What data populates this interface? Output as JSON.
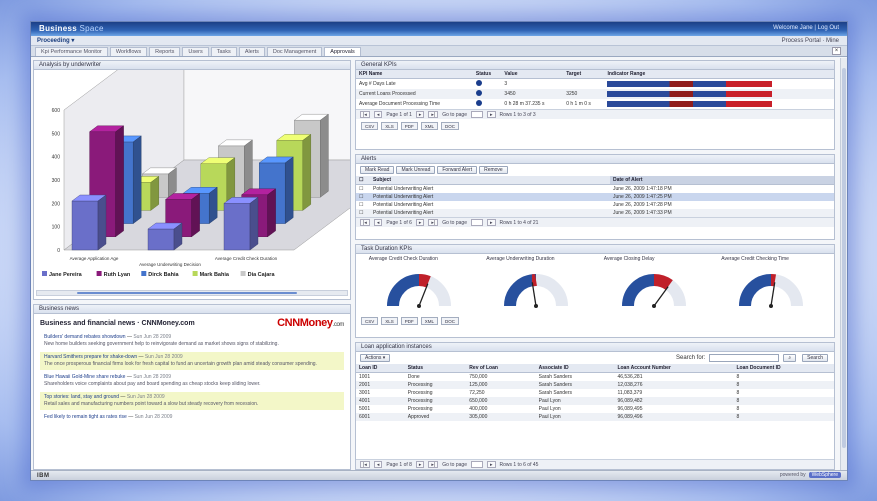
{
  "app": {
    "brand_main": "Business",
    "brand_sub": "Space",
    "top_right": "Welcome Jane | Log Out",
    "menu_title": "Proceeding ▾",
    "menu_right": "Process Portal · Mine"
  },
  "tabs": [
    {
      "label": "Kpi Performance Monitor"
    },
    {
      "label": "Workflows"
    },
    {
      "label": "Reports"
    },
    {
      "label": "Users"
    },
    {
      "label": "Tasks"
    },
    {
      "label": "Alerts"
    },
    {
      "label": "Doc Management"
    },
    {
      "label": "Approvals"
    }
  ],
  "chart_panel": {
    "title": "Analysis by underwriter"
  },
  "chart_data": {
    "type": "bar",
    "title": "",
    "categories": [
      "Average Application Age",
      "Average Underwriting Decision",
      "Average Credit Check Duration"
    ],
    "ylim": [
      0,
      600
    ],
    "yticks": [
      "0",
      "100",
      "200",
      "300",
      "400",
      "500",
      "600"
    ],
    "series": [
      {
        "name": "Jane Pereira",
        "color": "#6a6fc9",
        "values": [
          210,
          90,
          200
        ]
      },
      {
        "name": "Ruth Lyan",
        "color": "#8a1a7a",
        "values": [
          450,
          160,
          180
        ]
      },
      {
        "name": "Dirck Bahia",
        "color": "#4474cc",
        "values": [
          350,
          130,
          260
        ]
      },
      {
        "name": "Mark Bahia",
        "color": "#b8d85a",
        "values": [
          120,
          200,
          300
        ]
      },
      {
        "name": "Dia Cajara",
        "color": "#c8c8c8",
        "values": [
          100,
          220,
          330
        ]
      }
    ],
    "legend_position": "bottom",
    "grid": true
  },
  "news": {
    "panel_title": "Business news",
    "heading": "Business and financial news · CNNMoney.com",
    "logo_main": "CNNMoney",
    "logo_sub": ".com",
    "items": [
      {
        "title": "Builders' demand rebates showdown",
        "date": "Sun Jun 28 2009",
        "desc": "New home builders seeking government help to reinvigorate demand as market shows signs of stabilizing.",
        "highlight": false
      },
      {
        "title": "Harvard Smithers prepare for shake-down",
        "date": "Sun Jun 28 2009",
        "desc": "The once prosperous financial firms look for fresh capital to fund an uncertain growth plan amid steady consumer spending.",
        "highlight": true
      },
      {
        "title": "Blue Hawaii Gold-Mine share rebuke",
        "date": "Sun Jun 28 2009",
        "desc": "Shareholders voice complaints about pay and board spending as cheap stocks keep sliding lower.",
        "highlight": false
      },
      {
        "title": "Top stories: land, stay and ground",
        "date": "Sun Jun 28 2009",
        "desc": "Retail sales and manufacturing numbers point toward a slow but steady recovery from recession.",
        "highlight": true
      },
      {
        "title": "Fed likely to remain tight as rates rise",
        "date": "Sun Jun 28 2009",
        "desc": "",
        "highlight": false
      }
    ]
  },
  "kpis": {
    "panel_title": "General KPIs",
    "headers": [
      "KPI Name",
      "Status",
      "Value",
      "Target",
      "Indicator Range"
    ],
    "rows": [
      {
        "name": "Avg # Days Late",
        "value": "3",
        "target": ""
      },
      {
        "name": "Current Loans Processed",
        "value": "3450",
        "target": "3250"
      },
      {
        "name": "Average Document Processing Time",
        "value": "0 h 28 m 37.235 s",
        "target": "0 h 1 m 0 s"
      }
    ],
    "pager": "Page 1 of 1",
    "goto": "Go to page",
    "rows_label": "Rows 1 to 3 of 3",
    "export": [
      "CSV",
      "XLS",
      "PDF",
      "XML",
      "DOC"
    ]
  },
  "alerts": {
    "panel_title": "Alerts",
    "buttons": [
      "Mark Read",
      "Mark Unread",
      "Forward Alert",
      "Remove"
    ],
    "headers": [
      "Subject",
      "Date of Alert"
    ],
    "rows": [
      {
        "subject": "Potential Underwriting Alert",
        "date": "June 26, 2009 1:47:18 PM"
      },
      {
        "subject": "Potential Underwriting Alert",
        "date": "June 26, 2009 1:47:25 PM"
      },
      {
        "subject": "Potential Underwriting Alert",
        "date": "June 26, 2009 1:47:28 PM"
      },
      {
        "subject": "Potential Underwriting Alert",
        "date": "June 26, 2009 1:47:33 PM"
      }
    ],
    "pager": "Page 1 of 6",
    "goto": "Go to page",
    "rows_label": "Rows 1 to 4 of 21"
  },
  "gauges": {
    "panel_title": "Task Duration KPIs",
    "items": [
      {
        "label": "Average Credit Check Duration",
        "value": 0.62,
        "color": "#c0202a"
      },
      {
        "label": "Average Underwriting Duration",
        "value": 0.45,
        "color": "#c0202a"
      },
      {
        "label": "Average Closing Delay",
        "value": 0.7,
        "color": "#c0202a"
      },
      {
        "label": "Average Credit Checking Time",
        "value": 0.55,
        "color": "#c0202a"
      }
    ],
    "export": [
      "CSV",
      "XLS",
      "PDF",
      "XML",
      "DOC"
    ]
  },
  "loans": {
    "panel_title": "Loan application instances",
    "action": "Actions",
    "search_label": "Search for:",
    "search_placeholder": "",
    "search_button": "Search",
    "headers": [
      "Loan ID",
      "Status",
      "Rev of Loan",
      "Associate ID",
      "Loan Account Number",
      "Loan Document ID"
    ],
    "rows": [
      {
        "id": "1001",
        "status": "Done",
        "rev": "750,000",
        "assoc": "Sarah Sanders",
        "acct": "46,536,281",
        "doc": "8"
      },
      {
        "id": "2001",
        "status": "Processing",
        "rev": "125,000",
        "assoc": "Sarah Sanders",
        "acct": "12,038,276",
        "doc": "8"
      },
      {
        "id": "3001",
        "status": "Processing",
        "rev": "72,250",
        "assoc": "Sarah Sanders",
        "acct": "11,083,379",
        "doc": "8"
      },
      {
        "id": "4001",
        "status": "Processing",
        "rev": "650,000",
        "assoc": "Paul Lyon",
        "acct": "96,089,482",
        "doc": "8"
      },
      {
        "id": "5001",
        "status": "Processing",
        "rev": "400,000",
        "assoc": "Paul Lyon",
        "acct": "96,089,495",
        "doc": "8"
      },
      {
        "id": "6001",
        "status": "Approved",
        "rev": "305,000",
        "assoc": "Paul Lyon",
        "acct": "96,089,496",
        "doc": "8"
      }
    ],
    "pager": "Page 1 of 8",
    "goto": "Go to page",
    "rows_label": "Rows 1 to 6 of 45"
  },
  "footer": {
    "ibm": "IBM",
    "powered_by": "powered by",
    "powered_logo": "WebSphere"
  }
}
